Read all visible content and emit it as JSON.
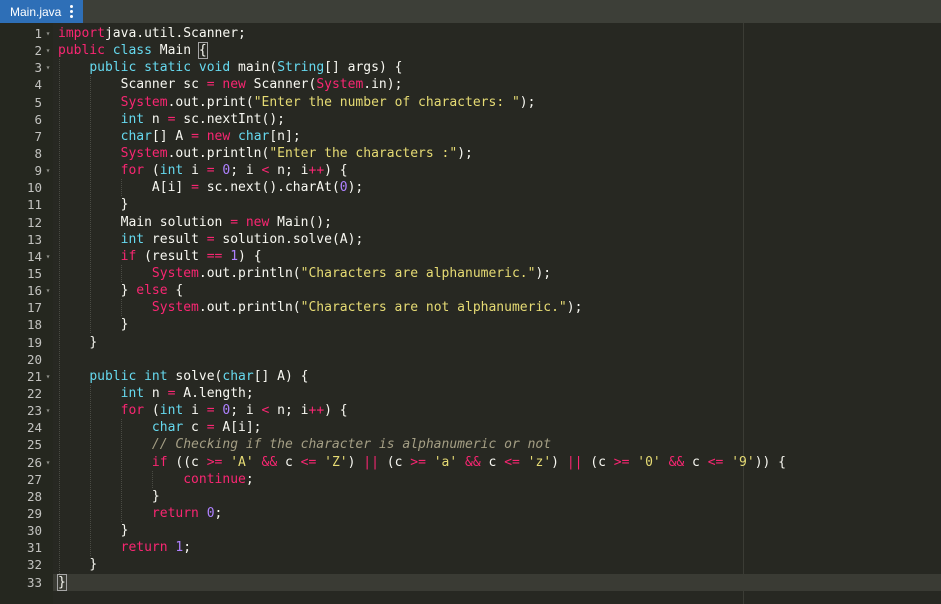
{
  "tab": {
    "title": "Main.java",
    "menu_icon": "vertical-ellipsis-icon"
  },
  "colors": {
    "tab_background": "#2e6fb7",
    "editor_background": "#272822",
    "gutter_background": "#25271f",
    "keyword": "#f92672",
    "type": "#66d9ef",
    "string": "#e6db74",
    "number": "#ae81ff",
    "comment": "#a59f85",
    "text": "#f8f8f2"
  },
  "editor": {
    "active_line": 33,
    "lines": [
      {
        "n": "1",
        "fold": true,
        "indent": 0,
        "tokens": [
          [
            "kw",
            "import"
          ],
          [
            "",
            "java.util.Scanner;"
          ]
        ]
      },
      {
        "n": "2",
        "fold": true,
        "indent": 0,
        "tokens": [
          [
            "kw",
            "public"
          ],
          [
            "",
            " "
          ],
          [
            "tp",
            "class"
          ],
          [
            "",
            " Main "
          ],
          [
            "br",
            "{"
          ]
        ]
      },
      {
        "n": "3",
        "fold": true,
        "indent": 1,
        "tokens": [
          [
            "tp",
            "public"
          ],
          [
            "",
            " "
          ],
          [
            "tp",
            "static"
          ],
          [
            "",
            " "
          ],
          [
            "tp",
            "void"
          ],
          [
            "",
            " main("
          ],
          [
            "tp",
            "String"
          ],
          [
            "",
            "[] args) {"
          ]
        ]
      },
      {
        "n": "4",
        "fold": false,
        "indent": 2,
        "tokens": [
          [
            "",
            "Scanner sc "
          ],
          [
            "op",
            "="
          ],
          [
            "",
            " "
          ],
          [
            "kw",
            "new"
          ],
          [
            "",
            " Scanner("
          ],
          [
            "sys",
            "System"
          ],
          [
            "",
            ".in);"
          ]
        ]
      },
      {
        "n": "5",
        "fold": false,
        "indent": 2,
        "tokens": [
          [
            "sys",
            "System"
          ],
          [
            "",
            ".out.print("
          ],
          [
            "str",
            "\"Enter the number of characters: \""
          ],
          [
            "",
            ");"
          ]
        ]
      },
      {
        "n": "6",
        "fold": false,
        "indent": 2,
        "tokens": [
          [
            "tp",
            "int"
          ],
          [
            "",
            " n "
          ],
          [
            "op",
            "="
          ],
          [
            "",
            " sc.nextInt();"
          ]
        ]
      },
      {
        "n": "7",
        "fold": false,
        "indent": 2,
        "tokens": [
          [
            "tp",
            "char"
          ],
          [
            "",
            "[] A "
          ],
          [
            "op",
            "="
          ],
          [
            "",
            " "
          ],
          [
            "kw",
            "new"
          ],
          [
            "",
            " "
          ],
          [
            "tp",
            "char"
          ],
          [
            "",
            "[n];"
          ]
        ]
      },
      {
        "n": "8",
        "fold": false,
        "indent": 2,
        "tokens": [
          [
            "sys",
            "System"
          ],
          [
            "",
            ".out.println("
          ],
          [
            "str",
            "\"Enter the characters :\""
          ],
          [
            "",
            ");"
          ]
        ]
      },
      {
        "n": "9",
        "fold": true,
        "indent": 2,
        "tokens": [
          [
            "kw",
            "for"
          ],
          [
            "",
            " ("
          ],
          [
            "tp",
            "int"
          ],
          [
            "",
            " i "
          ],
          [
            "op",
            "="
          ],
          [
            "",
            " "
          ],
          [
            "num",
            "0"
          ],
          [
            "",
            "; i "
          ],
          [
            "op",
            "<"
          ],
          [
            "",
            " n; i"
          ],
          [
            "op",
            "++"
          ],
          [
            "",
            ") {"
          ]
        ]
      },
      {
        "n": "10",
        "fold": false,
        "indent": 3,
        "tokens": [
          [
            "",
            "A[i] "
          ],
          [
            "op",
            "="
          ],
          [
            "",
            " sc.next().charAt("
          ],
          [
            "num",
            "0"
          ],
          [
            "",
            ");"
          ]
        ]
      },
      {
        "n": "11",
        "fold": false,
        "indent": 2,
        "tokens": [
          [
            "",
            "}"
          ]
        ]
      },
      {
        "n": "12",
        "fold": false,
        "indent": 2,
        "tokens": [
          [
            "",
            "Main solution "
          ],
          [
            "op",
            "="
          ],
          [
            "",
            " "
          ],
          [
            "kw",
            "new"
          ],
          [
            "",
            " Main();"
          ]
        ]
      },
      {
        "n": "13",
        "fold": false,
        "indent": 2,
        "tokens": [
          [
            "tp",
            "int"
          ],
          [
            "",
            " result "
          ],
          [
            "op",
            "="
          ],
          [
            "",
            " solution.solve(A);"
          ]
        ]
      },
      {
        "n": "14",
        "fold": true,
        "indent": 2,
        "tokens": [
          [
            "kw",
            "if"
          ],
          [
            "",
            " (result "
          ],
          [
            "op",
            "=="
          ],
          [
            "",
            " "
          ],
          [
            "num",
            "1"
          ],
          [
            "",
            ") {"
          ]
        ]
      },
      {
        "n": "15",
        "fold": false,
        "indent": 3,
        "tokens": [
          [
            "sys",
            "System"
          ],
          [
            "",
            ".out.println("
          ],
          [
            "str",
            "\"Characters are alphanumeric.\""
          ],
          [
            "",
            ");"
          ]
        ]
      },
      {
        "n": "16",
        "fold": true,
        "indent": 2,
        "tokens": [
          [
            "",
            "} "
          ],
          [
            "kw",
            "else"
          ],
          [
            "",
            " {"
          ]
        ]
      },
      {
        "n": "17",
        "fold": false,
        "indent": 3,
        "tokens": [
          [
            "sys",
            "System"
          ],
          [
            "",
            ".out.println("
          ],
          [
            "str",
            "\"Characters are not alphanumeric.\""
          ],
          [
            "",
            ");"
          ]
        ]
      },
      {
        "n": "18",
        "fold": false,
        "indent": 2,
        "tokens": [
          [
            "",
            "}"
          ]
        ]
      },
      {
        "n": "19",
        "fold": false,
        "indent": 1,
        "tokens": [
          [
            "",
            "}"
          ]
        ]
      },
      {
        "n": "20",
        "fold": false,
        "indent": 0,
        "tokens": []
      },
      {
        "n": "21",
        "fold": true,
        "indent": 1,
        "tokens": [
          [
            "tp",
            "public"
          ],
          [
            "",
            " "
          ],
          [
            "tp",
            "int"
          ],
          [
            "",
            " solve("
          ],
          [
            "tp",
            "char"
          ],
          [
            "",
            "[] A) {"
          ]
        ]
      },
      {
        "n": "22",
        "fold": false,
        "indent": 2,
        "tokens": [
          [
            "tp",
            "int"
          ],
          [
            "",
            " n "
          ],
          [
            "op",
            "="
          ],
          [
            "",
            " A.length;"
          ]
        ]
      },
      {
        "n": "23",
        "fold": true,
        "indent": 2,
        "tokens": [
          [
            "kw",
            "for"
          ],
          [
            "",
            " ("
          ],
          [
            "tp",
            "int"
          ],
          [
            "",
            " i "
          ],
          [
            "op",
            "="
          ],
          [
            "",
            " "
          ],
          [
            "num",
            "0"
          ],
          [
            "",
            "; i "
          ],
          [
            "op",
            "<"
          ],
          [
            "",
            " n; i"
          ],
          [
            "op",
            "++"
          ],
          [
            "",
            ") {"
          ]
        ]
      },
      {
        "n": "24",
        "fold": false,
        "indent": 3,
        "tokens": [
          [
            "tp",
            "char"
          ],
          [
            "",
            " c "
          ],
          [
            "op",
            "="
          ],
          [
            "",
            " A[i];"
          ]
        ]
      },
      {
        "n": "25",
        "fold": false,
        "indent": 3,
        "tokens": [
          [
            "cm",
            "// Checking if the character is alphanumeric or not"
          ]
        ]
      },
      {
        "n": "26",
        "fold": true,
        "indent": 3,
        "tokens": [
          [
            "kw",
            "if"
          ],
          [
            "",
            " ((c "
          ],
          [
            "op",
            ">="
          ],
          [
            "",
            " "
          ],
          [
            "str",
            "'A'"
          ],
          [
            "",
            " "
          ],
          [
            "op",
            "&&"
          ],
          [
            "",
            " c "
          ],
          [
            "op",
            "<="
          ],
          [
            "",
            " "
          ],
          [
            "str",
            "'Z'"
          ],
          [
            "",
            ") "
          ],
          [
            "op",
            "||"
          ],
          [
            "",
            " (c "
          ],
          [
            "op",
            ">="
          ],
          [
            "",
            " "
          ],
          [
            "str",
            "'a'"
          ],
          [
            "",
            " "
          ],
          [
            "op",
            "&&"
          ],
          [
            "",
            " c "
          ],
          [
            "op",
            "<="
          ],
          [
            "",
            " "
          ],
          [
            "str",
            "'z'"
          ],
          [
            "",
            ") "
          ],
          [
            "op",
            "||"
          ],
          [
            "",
            " (c "
          ],
          [
            "op",
            ">="
          ],
          [
            "",
            " "
          ],
          [
            "str",
            "'0'"
          ],
          [
            "",
            " "
          ],
          [
            "op",
            "&&"
          ],
          [
            "",
            " c "
          ],
          [
            "op",
            "<="
          ],
          [
            "",
            " "
          ],
          [
            "str",
            "'9'"
          ],
          [
            "",
            ")) {"
          ]
        ]
      },
      {
        "n": "27",
        "fold": false,
        "indent": 4,
        "tokens": [
          [
            "kw",
            "continue"
          ],
          [
            "",
            ";"
          ]
        ]
      },
      {
        "n": "28",
        "fold": false,
        "indent": 3,
        "tokens": [
          [
            "",
            "}"
          ]
        ]
      },
      {
        "n": "29",
        "fold": false,
        "indent": 3,
        "tokens": [
          [
            "kw",
            "return"
          ],
          [
            "",
            " "
          ],
          [
            "num",
            "0"
          ],
          [
            "",
            ";"
          ]
        ]
      },
      {
        "n": "30",
        "fold": false,
        "indent": 2,
        "tokens": [
          [
            "",
            "}"
          ]
        ]
      },
      {
        "n": "31",
        "fold": false,
        "indent": 2,
        "tokens": [
          [
            "kw",
            "return"
          ],
          [
            "",
            " "
          ],
          [
            "num",
            "1"
          ],
          [
            "",
            ";"
          ]
        ]
      },
      {
        "n": "32",
        "fold": false,
        "indent": 1,
        "tokens": [
          [
            "",
            "}"
          ]
        ]
      },
      {
        "n": "33",
        "fold": false,
        "indent": 0,
        "tokens": [
          [
            "br",
            "}"
          ]
        ]
      }
    ]
  }
}
